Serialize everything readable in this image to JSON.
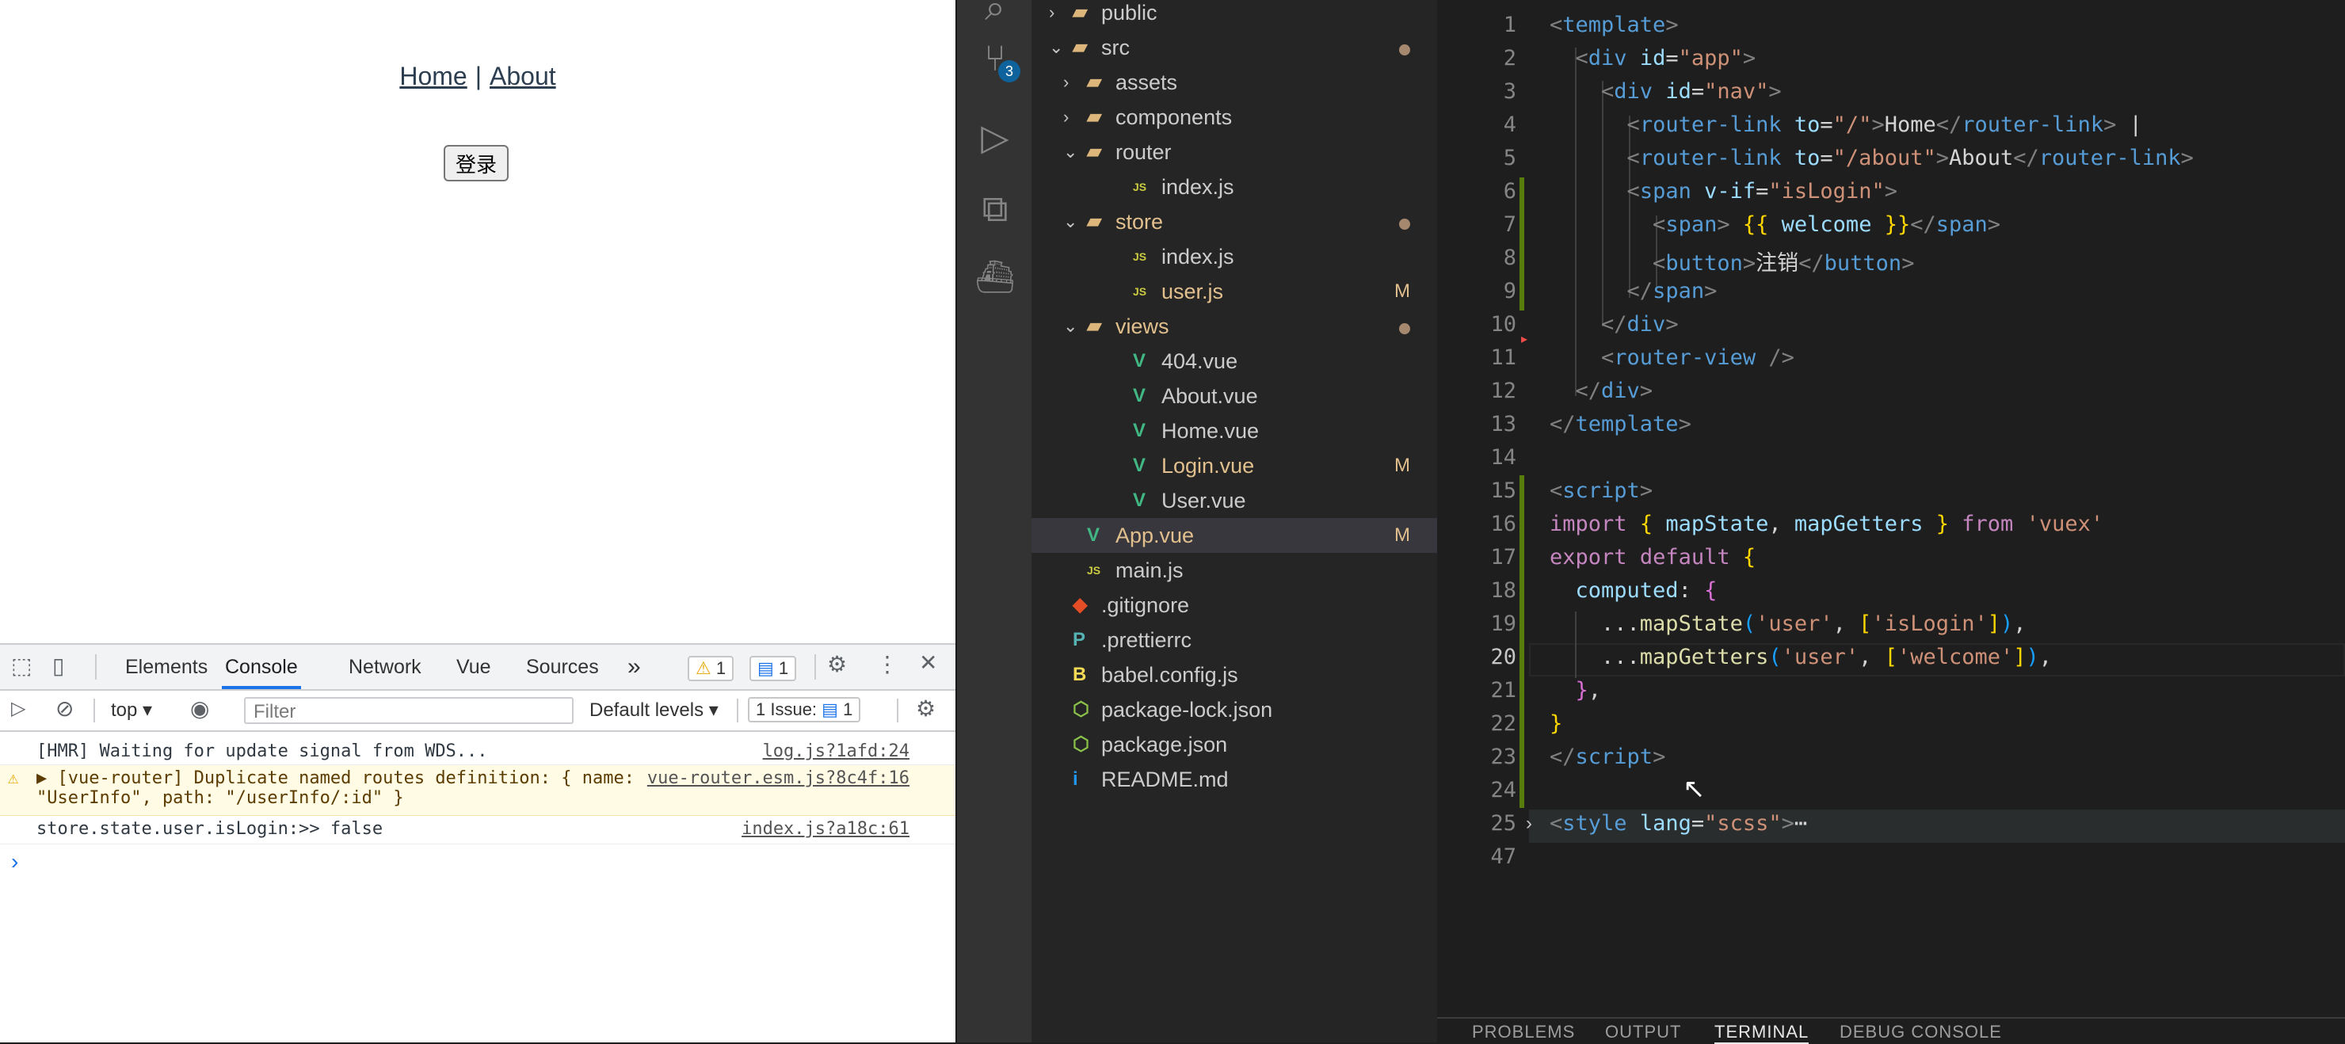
{
  "browser": {
    "nav": {
      "home": "Home",
      "separator": "|",
      "about": "About"
    },
    "login_button": "登录",
    "devtools": {
      "tabs": [
        "Elements",
        "Console",
        "Network",
        "Vue",
        "Sources"
      ],
      "more": "»",
      "warn_count": "1",
      "msg_count": "1",
      "context": "top",
      "filter_placeholder": "Filter",
      "levels": "Default levels",
      "issues_label": "1 Issue:",
      "issues_count": "1",
      "console": [
        {
          "text": "[HMR] Waiting for update signal from WDS...",
          "source": "log.js?1afd:24"
        },
        {
          "text": "▶ [vue-router] Duplicate named routes definition: { name:",
          "text2": "\"UserInfo\", path: \"/userInfo/:id\" }",
          "source": "vue-router.esm.js?8c4f:16"
        },
        {
          "text": "store.state.user.isLogin:>> false",
          "source": "index.js?a18c:61"
        }
      ],
      "prompt": "›"
    }
  },
  "activity": {
    "scm_badge": "3"
  },
  "explorer": {
    "items": [
      {
        "label": "public",
        "depth": 1,
        "type": "folder",
        "open": false
      },
      {
        "label": "src",
        "depth": 1,
        "type": "folder",
        "open": true,
        "dot": true
      },
      {
        "label": "assets",
        "depth": 2,
        "type": "folder",
        "open": false
      },
      {
        "label": "components",
        "depth": 2,
        "type": "folder",
        "open": false
      },
      {
        "label": "router",
        "depth": 2,
        "type": "folder",
        "open": true
      },
      {
        "label": "index.js",
        "depth": 3,
        "type": "js"
      },
      {
        "label": "store",
        "depth": 2,
        "type": "folder",
        "open": true,
        "dot": true,
        "modified": true
      },
      {
        "label": "index.js",
        "depth": 3,
        "type": "js"
      },
      {
        "label": "user.js",
        "depth": 3,
        "type": "js",
        "modified": true,
        "mark": "M"
      },
      {
        "label": "views",
        "depth": 2,
        "type": "folder",
        "open": true,
        "dot": true,
        "modified": true
      },
      {
        "label": "404.vue",
        "depth": 3,
        "type": "vue"
      },
      {
        "label": "About.vue",
        "depth": 3,
        "type": "vue"
      },
      {
        "label": "Home.vue",
        "depth": 3,
        "type": "vue"
      },
      {
        "label": "Login.vue",
        "depth": 3,
        "type": "vue",
        "modified": true,
        "mark": "M"
      },
      {
        "label": "User.vue",
        "depth": 3,
        "type": "vue"
      },
      {
        "label": "App.vue",
        "depth": 2,
        "type": "vue",
        "modified": true,
        "mark": "M",
        "selected": true
      },
      {
        "label": "main.js",
        "depth": 2,
        "type": "js"
      },
      {
        "label": ".gitignore",
        "depth": 1,
        "type": "git"
      },
      {
        "label": ".prettierrc",
        "depth": 1,
        "type": "prettier"
      },
      {
        "label": "babel.config.js",
        "depth": 1,
        "type": "babel"
      },
      {
        "label": "package-lock.json",
        "depth": 1,
        "type": "npm"
      },
      {
        "label": "package.json",
        "depth": 1,
        "type": "npm"
      },
      {
        "label": "README.md",
        "depth": 1,
        "type": "info"
      }
    ]
  },
  "editor": {
    "line_numbers": [
      "1",
      "2",
      "3",
      "4",
      "5",
      "6",
      "7",
      "8",
      "9",
      "10",
      "11",
      "12",
      "13",
      "14",
      "15",
      "16",
      "17",
      "18",
      "19",
      "20",
      "21",
      "22",
      "23",
      "24",
      "25",
      "47"
    ],
    "current_line": "20",
    "lines": [
      [
        [
          "t-punc",
          "<"
        ],
        [
          "t-tag",
          "template"
        ],
        [
          "t-punc",
          ">"
        ]
      ],
      [
        [
          "t-text",
          "  "
        ],
        [
          "t-punc",
          "<"
        ],
        [
          "t-tag",
          "div"
        ],
        [
          "t-text",
          " "
        ],
        [
          "t-attr",
          "id"
        ],
        [
          "t-text",
          "="
        ],
        [
          "t-str",
          "\"app\""
        ],
        [
          "t-punc",
          ">"
        ]
      ],
      [
        [
          "t-text",
          "    "
        ],
        [
          "t-punc",
          "<"
        ],
        [
          "t-tag",
          "div"
        ],
        [
          "t-text",
          " "
        ],
        [
          "t-attr",
          "id"
        ],
        [
          "t-text",
          "="
        ],
        [
          "t-str",
          "\"nav\""
        ],
        [
          "t-punc",
          ">"
        ]
      ],
      [
        [
          "t-text",
          "      "
        ],
        [
          "t-punc",
          "<"
        ],
        [
          "t-tag",
          "router-link"
        ],
        [
          "t-text",
          " "
        ],
        [
          "t-attr",
          "to"
        ],
        [
          "t-text",
          "="
        ],
        [
          "t-str",
          "\"/\""
        ],
        [
          "t-punc",
          ">"
        ],
        [
          "t-text",
          "Home"
        ],
        [
          "t-punc",
          "</"
        ],
        [
          "t-tag",
          "router-link"
        ],
        [
          "t-punc",
          ">"
        ],
        [
          "t-text",
          " |"
        ]
      ],
      [
        [
          "t-text",
          "      "
        ],
        [
          "t-punc",
          "<"
        ],
        [
          "t-tag",
          "router-link"
        ],
        [
          "t-text",
          " "
        ],
        [
          "t-attr",
          "to"
        ],
        [
          "t-text",
          "="
        ],
        [
          "t-str",
          "\"/about\""
        ],
        [
          "t-punc",
          ">"
        ],
        [
          "t-text",
          "About"
        ],
        [
          "t-punc",
          "</"
        ],
        [
          "t-tag",
          "router-link"
        ],
        [
          "t-punc",
          ">"
        ]
      ],
      [
        [
          "t-text",
          "      "
        ],
        [
          "t-punc",
          "<"
        ],
        [
          "t-tag",
          "span"
        ],
        [
          "t-text",
          " "
        ],
        [
          "t-attr",
          "v-if"
        ],
        [
          "t-text",
          "="
        ],
        [
          "t-str",
          "\"isLogin\""
        ],
        [
          "t-punc",
          ">"
        ]
      ],
      [
        [
          "t-text",
          "        "
        ],
        [
          "t-punc",
          "<"
        ],
        [
          "t-tag",
          "span"
        ],
        [
          "t-punc",
          ">"
        ],
        [
          "t-text",
          " "
        ],
        [
          "t-br1",
          "{{"
        ],
        [
          "t-text",
          " "
        ],
        [
          "t-var",
          "welcome"
        ],
        [
          "t-text",
          " "
        ],
        [
          "t-br1",
          "}}"
        ],
        [
          "t-punc",
          "</"
        ],
        [
          "t-tag",
          "span"
        ],
        [
          "t-punc",
          ">"
        ]
      ],
      [
        [
          "t-text",
          "        "
        ],
        [
          "t-punc",
          "<"
        ],
        [
          "t-tag",
          "button"
        ],
        [
          "t-punc",
          ">"
        ],
        [
          "t-text",
          "注销"
        ],
        [
          "t-punc",
          "</"
        ],
        [
          "t-tag",
          "button"
        ],
        [
          "t-punc",
          ">"
        ]
      ],
      [
        [
          "t-text",
          "      "
        ],
        [
          "t-punc",
          "</"
        ],
        [
          "t-tag",
          "span"
        ],
        [
          "t-punc",
          ">"
        ]
      ],
      [
        [
          "t-text",
          "    "
        ],
        [
          "t-punc",
          "</"
        ],
        [
          "t-tag",
          "div"
        ],
        [
          "t-punc",
          ">"
        ]
      ],
      [
        [
          "t-text",
          "    "
        ],
        [
          "t-punc",
          "<"
        ],
        [
          "t-tag",
          "router-view"
        ],
        [
          "t-text",
          " "
        ],
        [
          "t-punc",
          "/>"
        ]
      ],
      [
        [
          "t-text",
          "  "
        ],
        [
          "t-punc",
          "</"
        ],
        [
          "t-tag",
          "div"
        ],
        [
          "t-punc",
          ">"
        ]
      ],
      [
        [
          "t-punc",
          "</"
        ],
        [
          "t-tag",
          "template"
        ],
        [
          "t-punc",
          ">"
        ]
      ],
      [],
      [
        [
          "t-punc",
          "<"
        ],
        [
          "t-tag",
          "script"
        ],
        [
          "t-punc",
          ">"
        ]
      ],
      [
        [
          "t-kw",
          "import"
        ],
        [
          "t-text",
          " "
        ],
        [
          "t-br1",
          "{"
        ],
        [
          "t-text",
          " "
        ],
        [
          "t-var",
          "mapState"
        ],
        [
          "t-text",
          ", "
        ],
        [
          "t-var",
          "mapGetters"
        ],
        [
          "t-text",
          " "
        ],
        [
          "t-br1",
          "}"
        ],
        [
          "t-text",
          " "
        ],
        [
          "t-kw",
          "from"
        ],
        [
          "t-text",
          " "
        ],
        [
          "t-str",
          "'vuex'"
        ]
      ],
      [
        [
          "t-kw",
          "export"
        ],
        [
          "t-text",
          " "
        ],
        [
          "t-kw",
          "default"
        ],
        [
          "t-text",
          " "
        ],
        [
          "t-br1",
          "{"
        ]
      ],
      [
        [
          "t-text",
          "  "
        ],
        [
          "t-var",
          "computed"
        ],
        [
          "t-text",
          ": "
        ],
        [
          "t-br2",
          "{"
        ]
      ],
      [
        [
          "t-text",
          "    ..."
        ],
        [
          "t-fn",
          "mapState"
        ],
        [
          "t-br3",
          "("
        ],
        [
          "t-str",
          "'user'"
        ],
        [
          "t-text",
          ", "
        ],
        [
          "t-br1",
          "["
        ],
        [
          "t-str",
          "'isLogin'"
        ],
        [
          "t-br1",
          "]"
        ],
        [
          "t-br3",
          ")"
        ],
        [
          "t-text",
          ","
        ]
      ],
      [
        [
          "t-text",
          "    ..."
        ],
        [
          "t-fn",
          "mapGetters"
        ],
        [
          "t-br3",
          "("
        ],
        [
          "t-str",
          "'user'"
        ],
        [
          "t-text",
          ", "
        ],
        [
          "t-br1",
          "["
        ],
        [
          "t-str",
          "'welcome'"
        ],
        [
          "t-br1",
          "]"
        ],
        [
          "t-br3",
          ")"
        ],
        [
          "t-text",
          ","
        ]
      ],
      [
        [
          "t-text",
          "  "
        ],
        [
          "t-br2",
          "}"
        ],
        [
          "t-text",
          ","
        ]
      ],
      [
        [
          "t-br1",
          "}"
        ]
      ],
      [
        [
          "t-punc",
          "</"
        ],
        [
          "t-tag",
          "script"
        ],
        [
          "t-punc",
          ">"
        ]
      ],
      [],
      [
        [
          "t-punc",
          "<"
        ],
        [
          "t-tag",
          "style"
        ],
        [
          "t-text",
          " "
        ],
        [
          "t-attr",
          "lang"
        ],
        [
          "t-text",
          "="
        ],
        [
          "t-str",
          "\"scss\""
        ],
        [
          "t-punc",
          ">"
        ],
        [
          "t-text",
          "⋯"
        ]
      ],
      []
    ]
  },
  "panel": {
    "tabs": [
      "PROBLEMS",
      "OUTPUT",
      "TERMINAL",
      "DEBUG CONSOLE"
    ],
    "active": "TERMINAL"
  }
}
